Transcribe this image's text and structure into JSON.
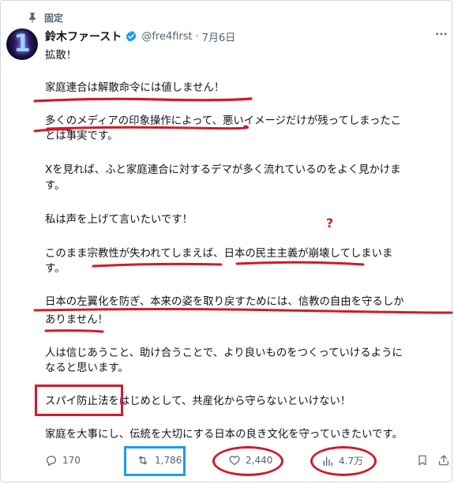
{
  "pinned": {
    "label": "固定"
  },
  "author": {
    "avatar_text": "1",
    "display_name": "鈴木ファースト",
    "handle": "@fre4first",
    "separator": "·",
    "date": "7月6日"
  },
  "post": {
    "lines": [
      "拡散！",
      "家庭連合は解散命令には値しません！",
      "多くのメディアの印象操作によって、悪いイメージだけが残ってしまったこ",
      "とは事実です。",
      "Xを見れば、ふと家庭連合に対するデマが多く流れているのをよく見かけま",
      "す。",
      "私は声を上げて言いたいです！",
      "このまま宗教性が失われてしまえば、日本の民主主義が崩壊してしまいま",
      "す。",
      "日本の左翼化を防ぎ、本来の姿を取り戻すためには、信教の自由を守るしか",
      "ありません！",
      "人は信じあうこと、助け合うことで、より良いものをつくっていけるように",
      "なると思います。",
      "スパイ防止法をはじめとして、共産化から守らないといけない！",
      "家庭を大事にし、伝統を大切にする日本の良き文化を守っていきたいです。"
    ]
  },
  "annotation": {
    "question_mark": "?"
  },
  "actions": {
    "reply_count": "170",
    "retweet_count": "1,786",
    "like_count": "2,440",
    "views_count": "4.7万"
  },
  "icons": {
    "pin": "pin-icon",
    "verified": "verified-badge-icon",
    "more": "more-options-icon",
    "reply": "reply-icon",
    "retweet": "retweet-icon",
    "like": "heart-icon",
    "views": "analytics-icon",
    "bookmark": "bookmark-icon",
    "share": "share-icon"
  },
  "colors": {
    "text": "#0f1419",
    "muted": "#536471",
    "verified": "#1d9bf0",
    "annotation_red": "#d21a2a",
    "annotation_blue": "#1d9bf0"
  }
}
